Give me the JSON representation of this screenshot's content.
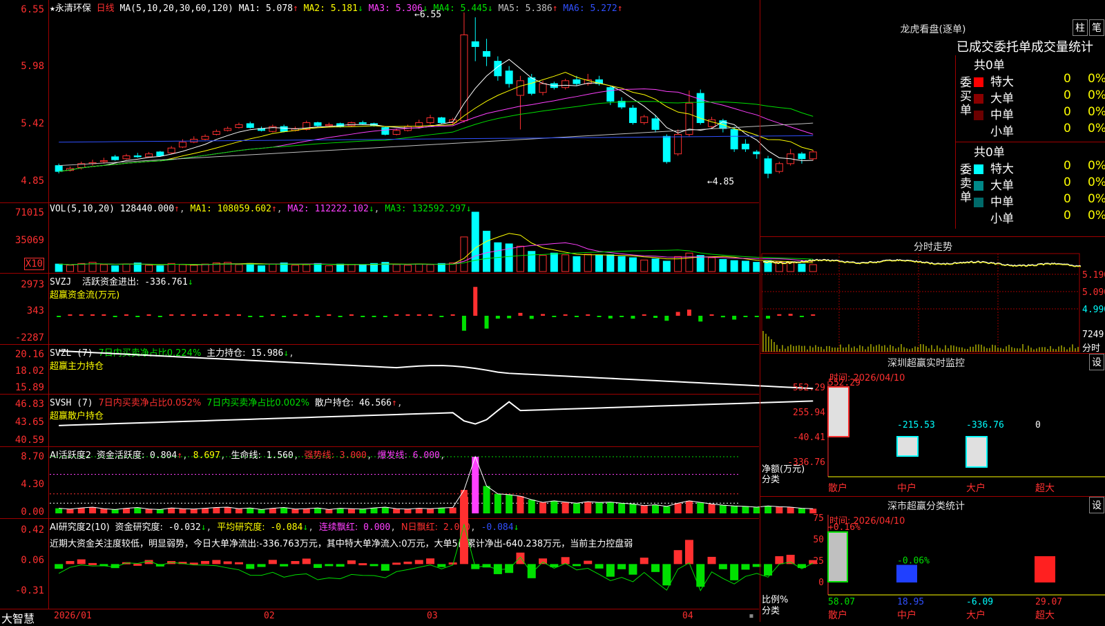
{
  "colors": {
    "up": "#ff3030",
    "down": "#00ffff",
    "grid": "#a00000",
    "yellow": "#ffff00",
    "magenta": "#ff40ff",
    "green": "#00e000",
    "blue": "#3050ff",
    "white": "#ffffff"
  },
  "kline": {
    "stock_name": "永清环保",
    "period": "日线",
    "ma_params": "MA(5,10,20,30,60,120)",
    "ma": [
      {
        "label": "MA1:",
        "value": "5.078",
        "arrow": "↑"
      },
      {
        "label": "MA2:",
        "value": "5.181",
        "arrow": "↓"
      },
      {
        "label": "MA3:",
        "value": "5.306",
        "arrow": "↓"
      },
      {
        "label": "MA4:",
        "value": "5.445",
        "arrow": "↓"
      },
      {
        "label": "MA5:",
        "value": "5.386",
        "arrow": "↑"
      },
      {
        "label": "MA6:",
        "value": "5.272",
        "arrow": "↑"
      }
    ],
    "yticks": [
      "6.55",
      "5.98",
      "5.42",
      "4.85"
    ],
    "high_label": "6.55",
    "low_label": "4.85",
    "candles": [
      [
        4.98,
        4.92,
        5.0,
        4.9
      ],
      [
        4.93,
        4.95,
        4.97,
        4.92
      ],
      [
        4.96,
        5.0,
        5.02,
        4.94
      ],
      [
        5.0,
        5.01,
        5.04,
        4.98
      ],
      [
        5.02,
        5.03,
        5.06,
        5.0
      ],
      [
        5.07,
        5.04,
        5.09,
        5.03
      ],
      [
        5.05,
        5.08,
        5.1,
        5.04
      ],
      [
        5.08,
        5.07,
        5.11,
        5.06
      ],
      [
        5.07,
        5.1,
        5.12,
        5.06
      ],
      [
        5.12,
        5.08,
        5.13,
        5.07
      ],
      [
        5.11,
        5.16,
        5.18,
        5.1
      ],
      [
        5.17,
        5.22,
        5.25,
        5.16
      ],
      [
        5.22,
        5.25,
        5.28,
        5.21
      ],
      [
        5.25,
        5.28,
        5.3,
        5.24
      ],
      [
        5.3,
        5.33,
        5.35,
        5.29
      ],
      [
        5.34,
        5.36,
        5.38,
        5.33
      ],
      [
        5.37,
        5.4,
        5.42,
        5.36
      ],
      [
        5.41,
        5.37,
        5.43,
        5.36
      ],
      [
        5.36,
        5.34,
        5.38,
        5.33
      ],
      [
        5.33,
        5.38,
        5.4,
        5.32
      ],
      [
        5.38,
        5.33,
        5.4,
        5.32
      ],
      [
        5.34,
        5.36,
        5.38,
        5.33
      ],
      [
        5.35,
        5.42,
        5.44,
        5.34
      ],
      [
        5.42,
        5.39,
        5.43,
        5.38
      ],
      [
        5.39,
        5.4,
        5.42,
        5.38
      ],
      [
        5.41,
        5.38,
        5.42,
        5.37
      ],
      [
        5.39,
        5.42,
        5.43,
        5.38
      ],
      [
        5.42,
        5.41,
        5.44,
        5.4
      ],
      [
        5.41,
        5.39,
        5.42,
        5.38
      ],
      [
        5.37,
        5.3,
        5.38,
        5.29
      ],
      [
        5.3,
        5.34,
        5.36,
        5.29
      ],
      [
        5.34,
        5.38,
        5.4,
        5.33
      ],
      [
        5.38,
        5.42,
        5.45,
        5.36
      ],
      [
        5.42,
        5.47,
        5.5,
        5.4
      ],
      [
        5.47,
        5.42,
        5.48,
        5.41
      ],
      [
        5.42,
        5.45,
        5.47,
        5.4
      ],
      [
        5.44,
        6.32,
        6.55,
        5.42
      ],
      [
        6.25,
        6.2,
        6.5,
        6.05
      ],
      [
        6.15,
        6.1,
        6.28,
        6.0
      ],
      [
        6.05,
        5.9,
        6.1,
        5.85
      ],
      [
        5.95,
        5.82,
        6.0,
        5.78
      ],
      [
        5.7,
        5.85,
        5.9,
        5.35
      ],
      [
        5.88,
        5.72,
        5.92,
        5.7
      ],
      [
        5.73,
        5.82,
        5.85,
        5.7
      ],
      [
        5.82,
        5.78,
        5.84,
        5.76
      ],
      [
        5.78,
        5.85,
        5.87,
        5.76
      ],
      [
        5.86,
        5.82,
        5.9,
        5.8
      ],
      [
        5.82,
        5.86,
        5.92,
        5.8
      ],
      [
        5.86,
        5.82,
        5.9,
        5.8
      ],
      [
        5.78,
        5.64,
        5.8,
        5.6
      ],
      [
        5.64,
        5.58,
        5.68,
        5.56
      ],
      [
        5.57,
        5.42,
        5.6,
        5.4
      ],
      [
        5.42,
        5.48,
        5.5,
        5.4
      ],
      [
        5.46,
        5.35,
        5.5,
        5.32
      ],
      [
        5.28,
        5.02,
        5.3,
        5.0
      ],
      [
        5.1,
        5.3,
        5.35,
        5.08
      ],
      [
        5.3,
        5.62,
        5.75,
        5.28
      ],
      [
        5.72,
        5.42,
        5.76,
        5.4
      ],
      [
        5.38,
        5.45,
        5.48,
        5.36
      ],
      [
        5.44,
        5.36,
        5.46,
        5.32
      ],
      [
        5.35,
        5.15,
        5.38,
        5.12
      ],
      [
        5.2,
        5.15,
        5.25,
        5.12
      ],
      [
        5.12,
        5.1,
        5.14,
        5.05
      ],
      [
        5.05,
        4.9,
        5.08,
        4.85
      ],
      [
        4.92,
        5.0,
        5.02,
        4.9
      ],
      [
        5.0,
        5.1,
        5.15,
        4.98
      ],
      [
        5.1,
        5.05,
        5.12,
        5.0
      ],
      [
        5.05,
        5.12,
        5.14,
        5.03
      ]
    ]
  },
  "volume": {
    "title": "VOL(5,10,20)",
    "value": "128440.000",
    "value_arrow": "↑",
    "ma": [
      {
        "label": "MA1:",
        "value": "108059.602",
        "arrow": "↑"
      },
      {
        "label": "MA2:",
        "value": "112222.102",
        "arrow": "↓"
      },
      {
        "label": "MA3:",
        "value": "132592.297",
        "arrow": "↓"
      }
    ],
    "yticks": [
      "71015",
      "35069"
    ],
    "unit": "X10",
    "bars": [
      1.3,
      1.1,
      1.4,
      1.6,
      1.2,
      1.0,
      1.3,
      1.5,
      1.1,
      1.0,
      1.4,
      1.2,
      1.1,
      1.3,
      1.5,
      1.6,
      1.2,
      1.4,
      1.0,
      1.3,
      1.5,
      1.1,
      1.2,
      1.4,
      1.0,
      1.3,
      1.2,
      1.1,
      1.4,
      1.6,
      1.2,
      1.1,
      1.3,
      1.2,
      1.4,
      1.5,
      6.0,
      10.3,
      7.0,
      5.0,
      4.8,
      4.4,
      3.5,
      2.8,
      3.2,
      2.9,
      2.6,
      3.0,
      2.8,
      2.9,
      2.6,
      2.4,
      2.0,
      2.2,
      1.8,
      2.6,
      3.2,
      2.8,
      2.4,
      2.1,
      1.9,
      1.8,
      1.6,
      1.9,
      1.7,
      1.6,
      1.3,
      1.2
    ]
  },
  "svzj": {
    "title": "SVZJ",
    "label": "活跃资金进出:",
    "value": "-336.761",
    "arrow": "↓",
    "subtitle": "超赢资金流(万元)",
    "yticks": [
      "2973",
      "343",
      "-2287"
    ]
  },
  "svzl": {
    "title": "SVZL (7)",
    "t1": "7日内买卖净占比0.224%",
    "t2": "主力持仓:",
    "value": "15.986",
    "arrow": "↓",
    "subtitle": "超赢主力持仓",
    "yticks": [
      "20.16",
      "18.02",
      "15.89"
    ]
  },
  "svsh": {
    "title": "SVSH (7)",
    "t1": "7日内买卖净占比0.052%",
    "t2": "7日内买卖净占比0.002%",
    "t3": "散户持仓:",
    "value": "46.566",
    "arrow": "↑",
    "subtitle": "超赢散户持仓",
    "yticks": [
      "46.83",
      "43.65",
      "40.59"
    ]
  },
  "ai_active": {
    "title": "AI活跃度2",
    "t1": "资金活跃度:",
    "v1": "0.804",
    "v1_arrow": "↑",
    "v2": "8.697",
    "t3": "生命线:",
    "v3": "1.560",
    "t4": "强势线:",
    "v4": "3.000",
    "t5": "爆发线:",
    "v5": "6.000",
    "yticks": [
      "8.70",
      "4.30",
      "0.00"
    ]
  },
  "ai_research": {
    "title": "AI研究度2(10)",
    "t1": "资金研究度:",
    "v1": "-0.032",
    "v1_arrow": "↓",
    "t2": "平均研究度:",
    "v2": "-0.084",
    "v2_arrow": "↓",
    "t3": "连续飘红:",
    "v3": "0.000",
    "t4": "N日飘红:",
    "v4": "2.000",
    "v5": "-0.084",
    "v5_arrow": "↓",
    "summary": "近期大资金关注度较低，明显弱势，今日大单净流出:-336.763万元，其中特大单净流入:0万元，大单5日累计净出-640.238万元，当前主力控盘弱",
    "yticks": [
      "0.42",
      "0.06",
      "-0.31"
    ]
  },
  "xaxis": {
    "brand": "大智慧",
    "labels": [
      "2026/01",
      "02",
      "03",
      "04"
    ]
  },
  "lhb": {
    "title": "龙虎看盘(逐单)",
    "btn1": "柱",
    "btn2": "笔",
    "tabs": "已成交委托单成交量统计",
    "buy": {
      "side": "委买单",
      "total": "共0单",
      "rows": [
        {
          "name": "特大",
          "count": "0",
          "pct": "0%",
          "color": "#ff0000"
        },
        {
          "name": "大单",
          "count": "0",
          "pct": "0%",
          "color": "#8a0000"
        },
        {
          "name": "中单",
          "count": "0",
          "pct": "0%",
          "color": "#6a0000"
        },
        {
          "name": "小单",
          "count": "0",
          "pct": "0%",
          "color": "#000000"
        }
      ]
    },
    "sell": {
      "side": "委卖单",
      "total": "共0单",
      "rows": [
        {
          "name": "特大",
          "count": "0",
          "pct": "0%",
          "color": "#00ffff"
        },
        {
          "name": "大单",
          "count": "0",
          "pct": "0%",
          "color": "#008888"
        },
        {
          "name": "中单",
          "count": "0",
          "pct": "0%",
          "color": "#006a6a"
        },
        {
          "name": "小单",
          "count": "0",
          "pct": "0%",
          "color": "#000000"
        }
      ]
    }
  },
  "intraday": {
    "title": "分时走势",
    "yticks": [
      "5.190",
      "5.090",
      "4.990"
    ],
    "vol_label": "7249",
    "vol_unit": "分时"
  },
  "sz_monitor": {
    "title": "深圳超赢实时监控",
    "btn": "设",
    "time": "时间: 2026/04/10",
    "yticks": [
      "552.29",
      "255.94",
      "-40.41",
      "-336.76"
    ],
    "ylabel": "净额(万元)",
    "xlabel": "分类",
    "bars": [
      {
        "cat": "散户",
        "value": 552.29,
        "label": "552.29"
      },
      {
        "cat": "中户",
        "value": -215.53,
        "label": "-215.53"
      },
      {
        "cat": "大户",
        "value": -336.76,
        "label": "-336.76"
      },
      {
        "cat": "超大",
        "value": 0,
        "label": "0"
      }
    ]
  },
  "sz_class": {
    "title": "深市超赢分类统计",
    "btn": "设",
    "time": "时间: 2026/04/10",
    "yticks": [
      "75",
      "50",
      "25",
      "0"
    ],
    "ylabel": "比例%",
    "xlabel": "分类",
    "bars": [
      {
        "cat": "散户",
        "value": 58.07,
        "change": "+0.16%",
        "label": "58.07",
        "color": "#c0c0c0"
      },
      {
        "cat": "中户",
        "value": 18.95,
        "change": "-0.06%",
        "label": "18.95",
        "color": "#2040ff"
      },
      {
        "cat": "大户",
        "value": -6.09,
        "change": "",
        "label": "-6.09",
        "color": "#c0c0c0"
      },
      {
        "cat": "超大",
        "value": 29.07,
        "change": "",
        "label": "29.07",
        "color": "#ff2020"
      }
    ]
  }
}
